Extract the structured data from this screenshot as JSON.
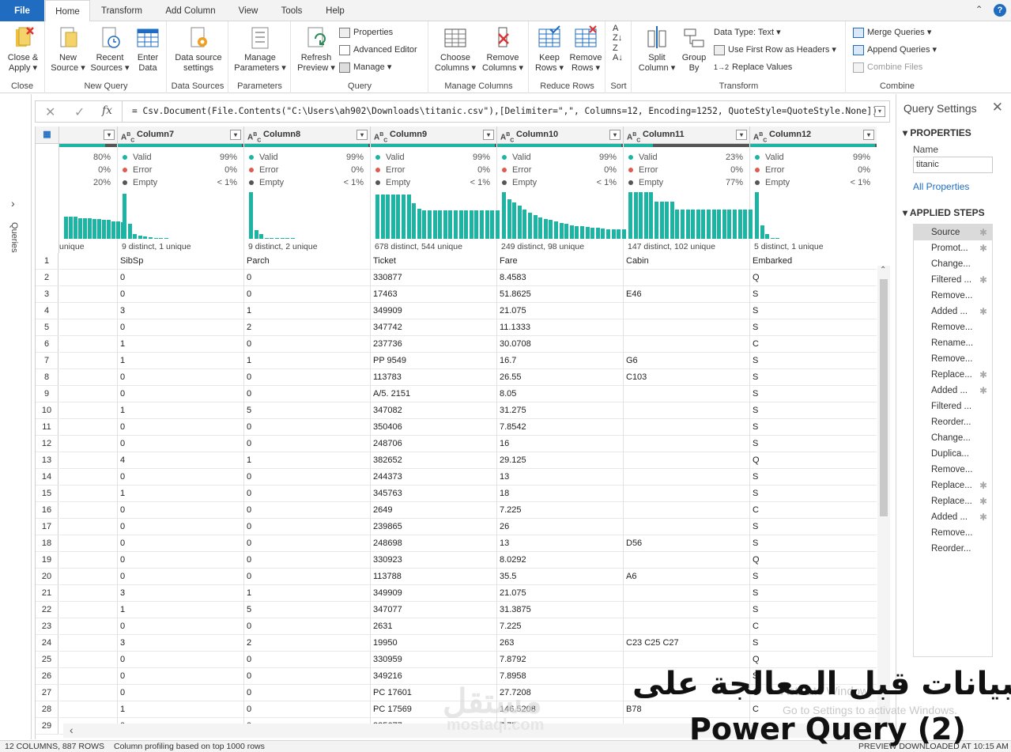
{
  "tabs": [
    "File",
    "Home",
    "Transform",
    "Add Column",
    "View",
    "Tools",
    "Help"
  ],
  "ribbon": {
    "close": {
      "btn1": "Close &",
      "btn1b": "Apply",
      "group": "Close"
    },
    "new_query": {
      "new": "New",
      "new_b": "Source",
      "recent": "Recent",
      "recent_b": "Sources",
      "enter": "Enter",
      "enter_b": "Data",
      "group": "New Query"
    },
    "data_sources": {
      "btn": "Data source",
      "btn_b": "settings",
      "group": "Data Sources"
    },
    "parameters": {
      "btn": "Manage",
      "btn_b": "Parameters",
      "group": "Parameters"
    },
    "query": {
      "refresh": "Refresh",
      "refresh_b": "Preview",
      "properties": "Properties",
      "advanced": "Advanced Editor",
      "manage": "Manage",
      "group": "Query"
    },
    "manage_columns": {
      "choose": "Choose",
      "choose_b": "Columns",
      "remove": "Remove",
      "remove_b": "Columns",
      "group": "Manage Columns"
    },
    "reduce_rows": {
      "keep": "Keep",
      "keep_b": "Rows",
      "remove": "Remove",
      "remove_b": "Rows",
      "group": "Reduce Rows"
    },
    "sort": {
      "group": "Sort"
    },
    "transform": {
      "split": "Split",
      "split_b": "Column",
      "groupby": "Group",
      "groupby_b": "By",
      "datatype": "Data Type: Text",
      "firstrow": "Use First Row as Headers",
      "replace": "Replace Values",
      "group": "Transform"
    },
    "combine": {
      "merge": "Merge Queries",
      "append": "Append Queries",
      "combine": "Combine Files",
      "group": "Combine"
    }
  },
  "queries_label": "Queries",
  "formula": "= Csv.Document(File.Contents(\"C:\\Users\\ah902\\Downloads\\titanic.csv\"),[Delimiter=\",\", Columns=12, Encoding=1252, QuoteStyle=QuoteStyle.None])",
  "columns": [
    {
      "name": "",
      "valid": "",
      "error": "",
      "empty": "",
      "valid_pct": "80%",
      "error_pct": "0%",
      "empty_pct": "20%",
      "distinct": "unique",
      "fill": 0.8,
      "bars": [
        0.45,
        0.45,
        0.45,
        0.42,
        0.42,
        0.42,
        0.4,
        0.4,
        0.38,
        0.38,
        0.36,
        0.35,
        0.34
      ]
    },
    {
      "name": "Column7",
      "valid": "Valid",
      "error": "Error",
      "empty": "Empty",
      "valid_pct": "99%",
      "error_pct": "0%",
      "empty_pct": "< 1%",
      "distinct": "9 distinct, 1 unique",
      "fill": 0.99,
      "bars": [
        0.92,
        0.3,
        0.09,
        0.06,
        0.05,
        0.03,
        0.02,
        0.01,
        0.01
      ]
    },
    {
      "name": "Column8",
      "valid": "Valid",
      "error": "Error",
      "empty": "Empty",
      "valid_pct": "99%",
      "error_pct": "0%",
      "empty_pct": "< 1%",
      "distinct": "9 distinct, 2 unique",
      "fill": 0.99,
      "bars": [
        0.95,
        0.18,
        0.09,
        0.02,
        0.02,
        0.01,
        0.01,
        0.01,
        0.01
      ]
    },
    {
      "name": "Column9",
      "valid": "Valid",
      "error": "Error",
      "empty": "Empty",
      "valid_pct": "99%",
      "error_pct": "0%",
      "empty_pct": "< 1%",
      "distinct": "678 distinct, 544 unique",
      "fill": 0.99,
      "bars": [
        0.9,
        0.9,
        0.9,
        0.9,
        0.9,
        0.9,
        0.9,
        0.72,
        0.62,
        0.58,
        0.58,
        0.58,
        0.58,
        0.58,
        0.58,
        0.58,
        0.58,
        0.58,
        0.58,
        0.58,
        0.58,
        0.58,
        0.58,
        0.58
      ]
    },
    {
      "name": "Column10",
      "valid": "Valid",
      "error": "Error",
      "empty": "Empty",
      "valid_pct": "99%",
      "error_pct": "0%",
      "empty_pct": "< 1%",
      "distinct": "249 distinct, 98 unique",
      "fill": 0.99,
      "bars": [
        0.95,
        0.8,
        0.74,
        0.68,
        0.6,
        0.54,
        0.48,
        0.44,
        0.41,
        0.38,
        0.35,
        0.32,
        0.3,
        0.28,
        0.26,
        0.25,
        0.24,
        0.23,
        0.22,
        0.21,
        0.2,
        0.2,
        0.19,
        0.19
      ]
    },
    {
      "name": "Column11",
      "valid": "Valid",
      "error": "Error",
      "empty": "Empty",
      "valid_pct": "23%",
      "error_pct": "0%",
      "empty_pct": "77%",
      "distinct": "147 distinct, 102 unique",
      "fill": 0.23,
      "bars": [
        0.95,
        0.95,
        0.95,
        0.95,
        0.95,
        0.75,
        0.75,
        0.75,
        0.75,
        0.6,
        0.6,
        0.6,
        0.6,
        0.6,
        0.6,
        0.6,
        0.6,
        0.6,
        0.6,
        0.6,
        0.6,
        0.6,
        0.6,
        0.6
      ]
    },
    {
      "name": "Column12",
      "valid": "Valid",
      "error": "Error",
      "empty": "Empty",
      "valid_pct": "99%",
      "error_pct": "0%",
      "empty_pct": "< 1%",
      "distinct": "5 distinct, 1 unique",
      "fill": 0.99,
      "bars": [
        0.95,
        0.28,
        0.09,
        0.01,
        0.01
      ]
    }
  ],
  "row1": [
    "",
    "SibSp",
    "Parch",
    "Ticket",
    "Fare",
    "Cabin",
    "Embarked"
  ],
  "rows": [
    [
      "0",
      "0",
      "330877",
      "8.4583",
      "",
      "Q"
    ],
    [
      "0",
      "0",
      "17463",
      "51.8625",
      "E46",
      "S"
    ],
    [
      "3",
      "1",
      "349909",
      "21.075",
      "",
      "S"
    ],
    [
      "0",
      "2",
      "347742",
      "11.1333",
      "",
      "S"
    ],
    [
      "1",
      "0",
      "237736",
      "30.0708",
      "",
      "C"
    ],
    [
      "1",
      "1",
      "PP 9549",
      "16.7",
      "G6",
      "S"
    ],
    [
      "0",
      "0",
      "113783",
      "26.55",
      "C103",
      "S"
    ],
    [
      "0",
      "0",
      "A/5. 2151",
      "8.05",
      "",
      "S"
    ],
    [
      "1",
      "5",
      "347082",
      "31.275",
      "",
      "S"
    ],
    [
      "0",
      "0",
      "350406",
      "7.8542",
      "",
      "S"
    ],
    [
      "0",
      "0",
      "248706",
      "16",
      "",
      "S"
    ],
    [
      "4",
      "1",
      "382652",
      "29.125",
      "",
      "Q"
    ],
    [
      "0",
      "0",
      "244373",
      "13",
      "",
      "S"
    ],
    [
      "1",
      "0",
      "345763",
      "18",
      "",
      "S"
    ],
    [
      "0",
      "0",
      "2649",
      "7.225",
      "",
      "C"
    ],
    [
      "0",
      "0",
      "239865",
      "26",
      "",
      "S"
    ],
    [
      "0",
      "0",
      "248698",
      "13",
      "D56",
      "S"
    ],
    [
      "0",
      "0",
      "330923",
      "8.0292",
      "",
      "Q"
    ],
    [
      "0",
      "0",
      "113788",
      "35.5",
      "A6",
      "S"
    ],
    [
      "3",
      "1",
      "349909",
      "21.075",
      "",
      "S"
    ],
    [
      "1",
      "5",
      "347077",
      "31.3875",
      "",
      "S"
    ],
    [
      "0",
      "0",
      "2631",
      "7.225",
      "",
      "C"
    ],
    [
      "3",
      "2",
      "19950",
      "263",
      "C23 C25 C27",
      "S"
    ],
    [
      "0",
      "0",
      "330959",
      "7.8792",
      "",
      "Q"
    ],
    [
      "0",
      "0",
      "349216",
      "7.8958",
      "",
      "S"
    ],
    [
      "0",
      "0",
      "PC 17601",
      "27.7208",
      "",
      "C"
    ],
    [
      "1",
      "0",
      "PC 17569",
      "146.5208",
      "B78",
      "C"
    ],
    [
      "0",
      "0",
      "335677",
      "7.75",
      "",
      "S"
    ]
  ],
  "query_settings": {
    "title": "Query Settings",
    "properties": "PROPERTIES",
    "name_label": "Name",
    "name_value": "titanic",
    "all_properties": "All Properties",
    "applied_steps": "APPLIED STEPS",
    "steps": [
      {
        "label": "Source",
        "gear": true
      },
      {
        "label": "Promot...",
        "gear": true
      },
      {
        "label": "Change...",
        "gear": false
      },
      {
        "label": "Filtered ...",
        "gear": true
      },
      {
        "label": "Remove...",
        "gear": false
      },
      {
        "label": "Added ...",
        "gear": true
      },
      {
        "label": "Remove...",
        "gear": false
      },
      {
        "label": "Rename...",
        "gear": false
      },
      {
        "label": "Remove...",
        "gear": false
      },
      {
        "label": "Replace...",
        "gear": true
      },
      {
        "label": "Added ...",
        "gear": true
      },
      {
        "label": "Filtered ...",
        "gear": false
      },
      {
        "label": "Reorder...",
        "gear": false
      },
      {
        "label": "Change...",
        "gear": false
      },
      {
        "label": "Duplica...",
        "gear": false
      },
      {
        "label": "Remove...",
        "gear": false
      },
      {
        "label": "Replace...",
        "gear": true
      },
      {
        "label": "Replace...",
        "gear": true
      },
      {
        "label": "Added ...",
        "gear": true
      },
      {
        "label": "Remove...",
        "gear": false
      },
      {
        "label": "Reorder...",
        "gear": false
      }
    ]
  },
  "status": {
    "left": "12 COLUMNS, 887 ROWS",
    "profiling": "Column profiling based on top 1000 rows",
    "right": "PREVIEW DOWNLOADED AT 10:15 AM"
  },
  "overlay": {
    "line1": "البيانات قبل المعالجة على",
    "line2": "Power Query (2)",
    "watermark": "مستقل",
    "watermark2": "mostaql.com"
  },
  "activate": {
    "line1": "Activate Windows",
    "line2": "Go to Settings to activate Windows."
  },
  "colors": {
    "accent": "#1f6cc1",
    "valid": "#1cb5a4",
    "error": "#e05b4f",
    "empty": "#555555"
  }
}
